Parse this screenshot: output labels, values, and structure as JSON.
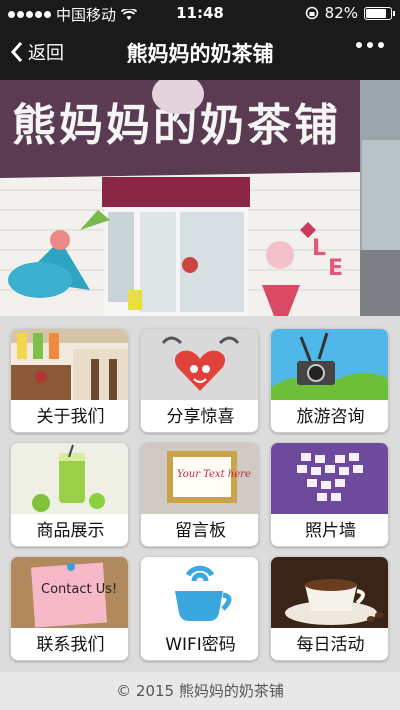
{
  "status": {
    "carrier": "中国移动",
    "time": "11:48",
    "battery": "82%",
    "battery_level": 0.82
  },
  "nav": {
    "back_label": "返回",
    "title": "熊妈妈的奶茶铺"
  },
  "banner": {
    "shop_sign": "熊妈妈的奶茶铺"
  },
  "tiles": [
    {
      "label": "关于我们",
      "icon": "cafe-interior-photo"
    },
    {
      "label": "分享惊喜",
      "icon": "heart-gift-icon"
    },
    {
      "label": "旅游咨询",
      "icon": "camera-landscape-icon"
    },
    {
      "label": "商品展示",
      "icon": "green-drink-photo"
    },
    {
      "label": "留言板",
      "icon": "message-board-photo"
    },
    {
      "label": "照片墙",
      "icon": "photo-heart-wall"
    },
    {
      "label": "联系我们",
      "icon": "contact-note-photo",
      "note_text": "Contact Us!"
    },
    {
      "label": "WIFI密码",
      "icon": "wifi-cup-icon"
    },
    {
      "label": "每日活动",
      "icon": "coffee-cup-photo"
    }
  ],
  "board_text": "Your Text here",
  "footer": {
    "copyright": "© 2015 熊妈妈的奶茶铺"
  }
}
